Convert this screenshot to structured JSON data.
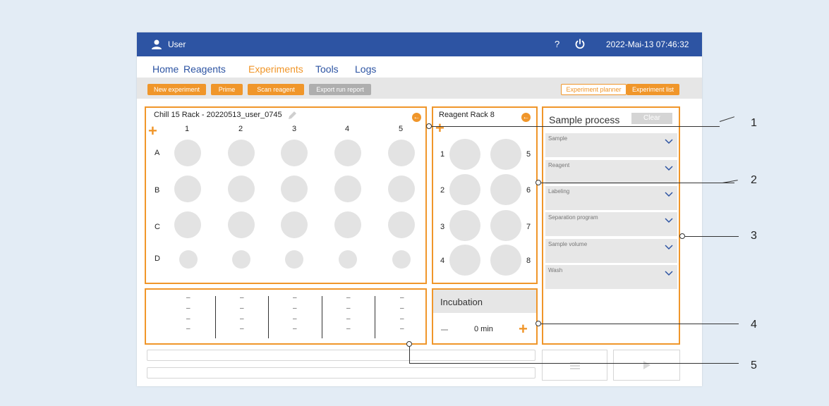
{
  "topbar": {
    "user_label": "User",
    "help_label": "?",
    "datetime": "2022-Mai-13  07:46:32"
  },
  "nav": {
    "items": [
      "Home",
      "Reagents",
      "Experiments",
      "Tools",
      "Logs"
    ],
    "active": "Experiments"
  },
  "toolbar": {
    "new_experiment": "New experiment",
    "prime": "Prime",
    "scan_reagent": "Scan reagent",
    "export_run_report": "Export run report",
    "experiment_planner": "Experiment planner",
    "experiment_list": "Experiment list"
  },
  "sample_rack": {
    "title": "Chill 15 Rack - 20220513_user_0745",
    "columns": [
      "1",
      "2",
      "3",
      "4",
      "5"
    ],
    "rows": [
      "A",
      "B",
      "C",
      "D"
    ]
  },
  "reagent_rack": {
    "title": "Reagent Rack 8",
    "left_slots": [
      "1",
      "2",
      "3",
      "4"
    ],
    "right_slots": [
      "5",
      "6",
      "7",
      "8"
    ]
  },
  "sample_process": {
    "title": "Sample process",
    "clear_label": "Clear",
    "dropdowns": [
      "Sample",
      "Reagent",
      "Labeling",
      "Separation program",
      "Sample volume",
      "Wash"
    ]
  },
  "incubation": {
    "title": "Incubation",
    "value": "0 min"
  },
  "summary": {
    "dash": "–"
  },
  "callouts": [
    "1",
    "2",
    "3",
    "4",
    "5"
  ],
  "colors": {
    "accent": "#f0962a",
    "brand": "#2d54a3",
    "well": "#e3e3e3",
    "background": "#e3ecf5"
  }
}
